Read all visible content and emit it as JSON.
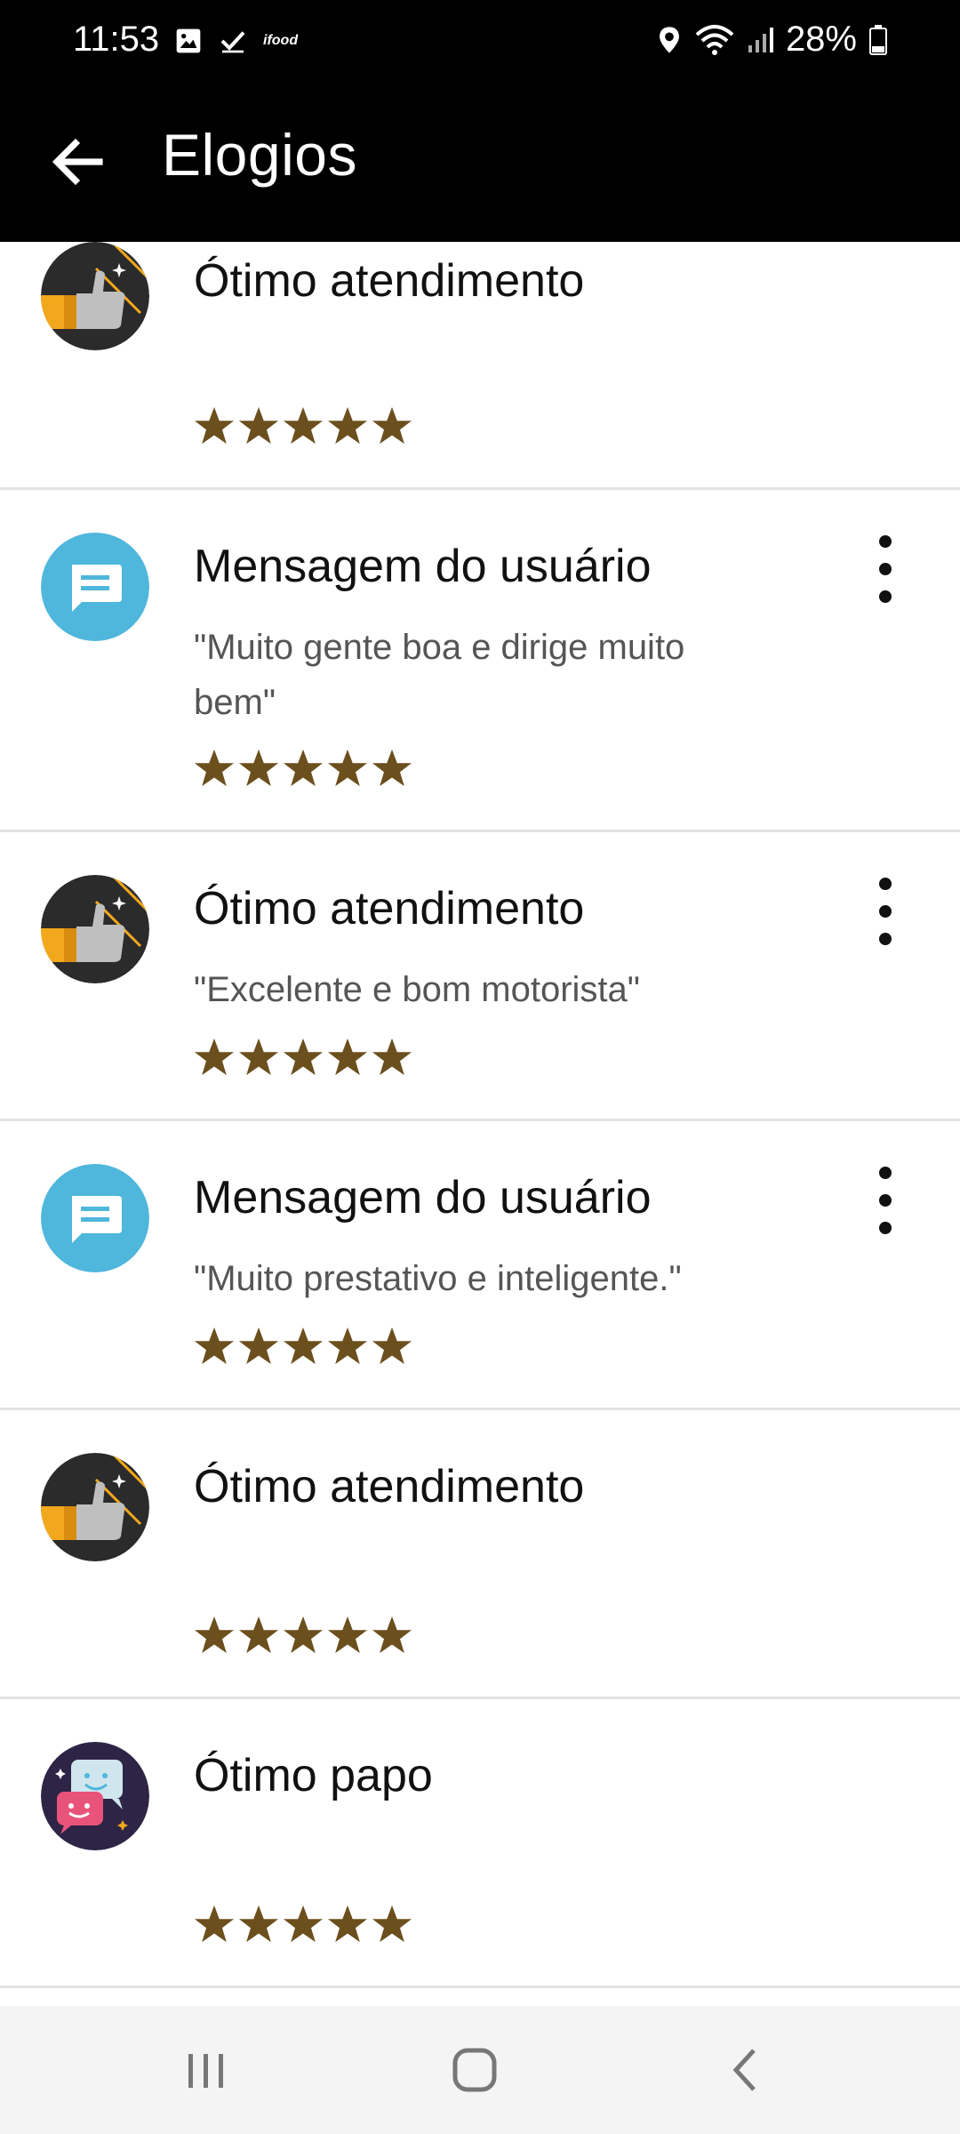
{
  "status_bar": {
    "time": "11:53",
    "battery": "28%",
    "icons": [
      "image-icon",
      "check-icon",
      "ifood-icon",
      "location-icon",
      "wifi-icon",
      "signal-icon",
      "battery-icon"
    ],
    "ifood_label": "ifood"
  },
  "app_bar": {
    "title": "Elogios",
    "back_icon": "arrow-back-icon"
  },
  "items": [
    {
      "type": "otimo-atendimento",
      "title": "Ótimo atendimento",
      "message": "",
      "rating": 5,
      "has_menu": false
    },
    {
      "type": "mensagem",
      "title": "Mensagem do usuário",
      "message": "\"Muito gente boa e dirige muito bem\"",
      "rating": 5,
      "has_menu": true
    },
    {
      "type": "otimo-atendimento",
      "title": "Ótimo atendimento",
      "message": "\"Excelente e bom motorista\"",
      "rating": 5,
      "has_menu": true
    },
    {
      "type": "mensagem",
      "title": "Mensagem do usuário",
      "message": "\"Muito prestativo e inteligente.\"",
      "rating": 5,
      "has_menu": true
    },
    {
      "type": "otimo-atendimento",
      "title": "Ótimo atendimento",
      "message": "",
      "rating": 5,
      "has_menu": false
    },
    {
      "type": "otimo-papo",
      "title": "Ótimo papo",
      "message": "",
      "rating": 5,
      "has_menu": false
    }
  ],
  "colors": {
    "star": "#6b4f1d",
    "message_icon_bg": "#4fb6dc",
    "badge_dark_bg": "#2b2b2b",
    "badge_purple_bg": "#2e2446",
    "divider": "#e3e3e3",
    "navbar_bg": "#f4f4f4"
  },
  "nav_bar": {
    "recents_icon": "recents-icon",
    "home_icon": "home-icon",
    "back_icon": "nav-back-icon"
  }
}
